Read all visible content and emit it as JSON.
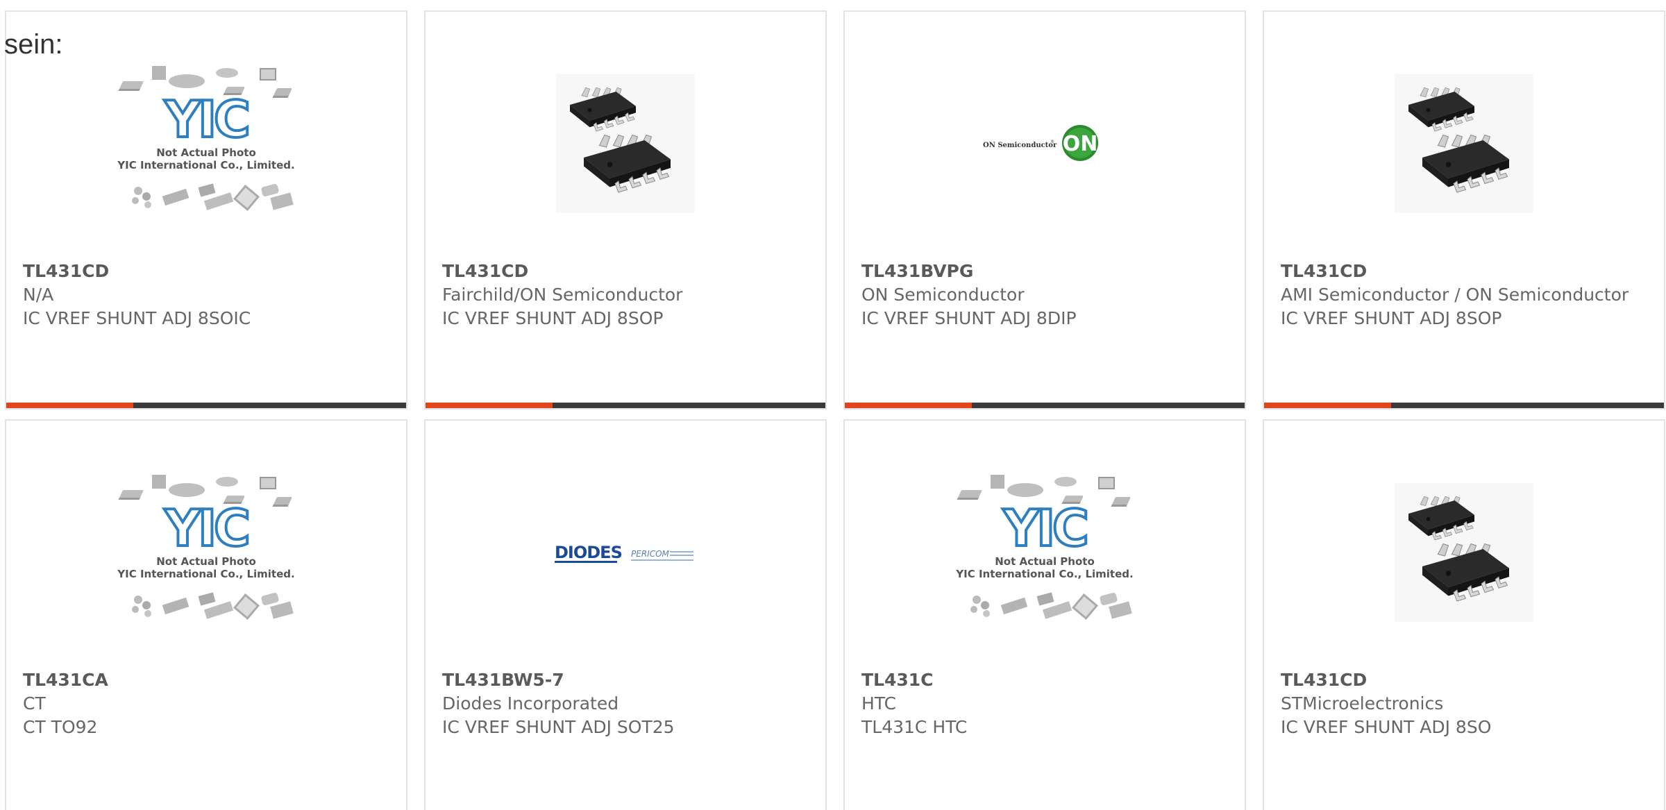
{
  "page": {
    "cut_label": "sein:"
  },
  "placeholder_image": {
    "line1": "Not Actual Photo",
    "line2": "YIC International Co., Limited.",
    "logo": "YIC"
  },
  "on_logo": {
    "text": "ON Semiconductor",
    "badge": "ON"
  },
  "diodes_logo": {
    "text": "DIODES",
    "sub": "PERICOM"
  },
  "colors": {
    "accent": "#e2451d",
    "bar": "#3a3a3a",
    "border": "#e3e3e3",
    "text": "#666666"
  },
  "products": [
    {
      "part": "TL431CD",
      "manufacturer": "N/A",
      "description": "IC VREF SHUNT ADJ 8SOIC",
      "image": "yic-placeholder"
    },
    {
      "part": "TL431CD",
      "manufacturer": "Fairchild/ON Semiconductor",
      "description": "IC VREF SHUNT ADJ 8SOP",
      "image": "soic8-chip"
    },
    {
      "part": "TL431BVPG",
      "manufacturer": "ON Semiconductor",
      "description": "IC VREF SHUNT ADJ 8DIP",
      "image": "on-semi-logo"
    },
    {
      "part": "TL431CD",
      "manufacturer": "AMI Semiconductor / ON Semiconductor",
      "description": "IC VREF SHUNT ADJ 8SOP",
      "image": "soic8-chip"
    },
    {
      "part": "TL431CA",
      "manufacturer": "CT",
      "description": "CT TO92",
      "image": "yic-placeholder"
    },
    {
      "part": "TL431BW5-7",
      "manufacturer": "Diodes Incorporated",
      "description": "IC VREF SHUNT ADJ SOT25",
      "image": "diodes-logo"
    },
    {
      "part": "TL431C",
      "manufacturer": "HTC",
      "description": "TL431C HTC",
      "image": "yic-placeholder"
    },
    {
      "part": "TL431CD",
      "manufacturer": "STMicroelectronics",
      "description": "IC VREF SHUNT ADJ 8SO",
      "image": "soic8-chip"
    }
  ]
}
